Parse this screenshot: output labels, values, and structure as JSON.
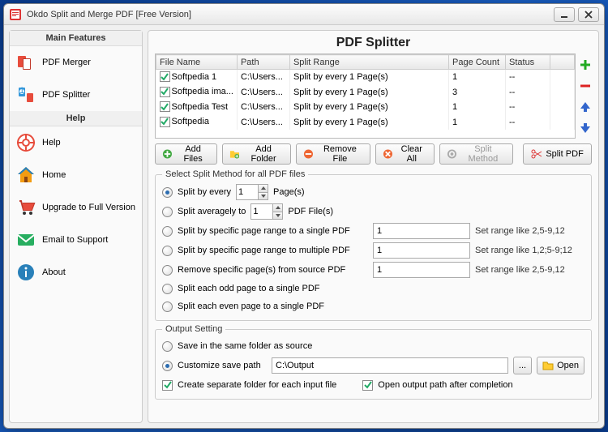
{
  "window": {
    "title": "Okdo Split and Merge PDF [Free Version]"
  },
  "sidebar": {
    "main_header": "Main Features",
    "help_header": "Help",
    "items": {
      "merger": "PDF Merger",
      "splitter": "PDF Splitter",
      "help": "Help",
      "home": "Home",
      "upgrade": "Upgrade to Full Version",
      "email": "Email to Support",
      "about": "About"
    }
  },
  "main": {
    "title": "PDF Splitter",
    "columns": {
      "file": "File Name",
      "path": "Path",
      "range": "Split Range",
      "count": "Page Count",
      "status": "Status"
    },
    "rows": [
      {
        "file": "Softpedia 1",
        "path": "C:\\Users...",
        "range": "Split by every 1 Page(s)",
        "count": "1",
        "status": "--"
      },
      {
        "file": "Softpedia ima...",
        "path": "C:\\Users...",
        "range": "Split by every 1 Page(s)",
        "count": "3",
        "status": "--"
      },
      {
        "file": "Softpedia Test",
        "path": "C:\\Users...",
        "range": "Split by every 1 Page(s)",
        "count": "1",
        "status": "--"
      },
      {
        "file": "Softpedia",
        "path": "C:\\Users...",
        "range": "Split by every 1 Page(s)",
        "count": "1",
        "status": "--"
      }
    ],
    "buttons": {
      "add_files": "Add Files",
      "add_folder": "Add Folder",
      "remove": "Remove File",
      "clear": "Clear All",
      "method": "Split Method",
      "split": "Split PDF"
    },
    "split_group": {
      "legend": "Select Split Method for all PDF files",
      "every_pre": "Split by every",
      "every_val": "1",
      "every_post": "Page(s)",
      "avg_pre": "Split averagely to",
      "avg_val": "1",
      "avg_post": "PDF File(s)",
      "range_single": "Split by specific page range to a single PDF",
      "range_single_val": "1",
      "range_single_hint": "Set range like 2,5-9,12",
      "range_multi": "Split by specific page range to multiple PDF",
      "range_multi_val": "1",
      "range_multi_hint": "Set range like 1,2;5-9;12",
      "remove": "Remove specific page(s) from source PDF",
      "remove_val": "1",
      "remove_hint": "Set range like 2,5-9,12",
      "odd": "Split each odd page to a single PDF",
      "even": "Split each even page to a single PDF"
    },
    "output": {
      "legend": "Output Setting",
      "same": "Save in the same folder as source",
      "custom": "Customize save path",
      "path": "C:\\Output",
      "browse": "...",
      "open": "Open",
      "sep": "Create separate folder for each input file",
      "after": "Open output path after completion"
    }
  }
}
